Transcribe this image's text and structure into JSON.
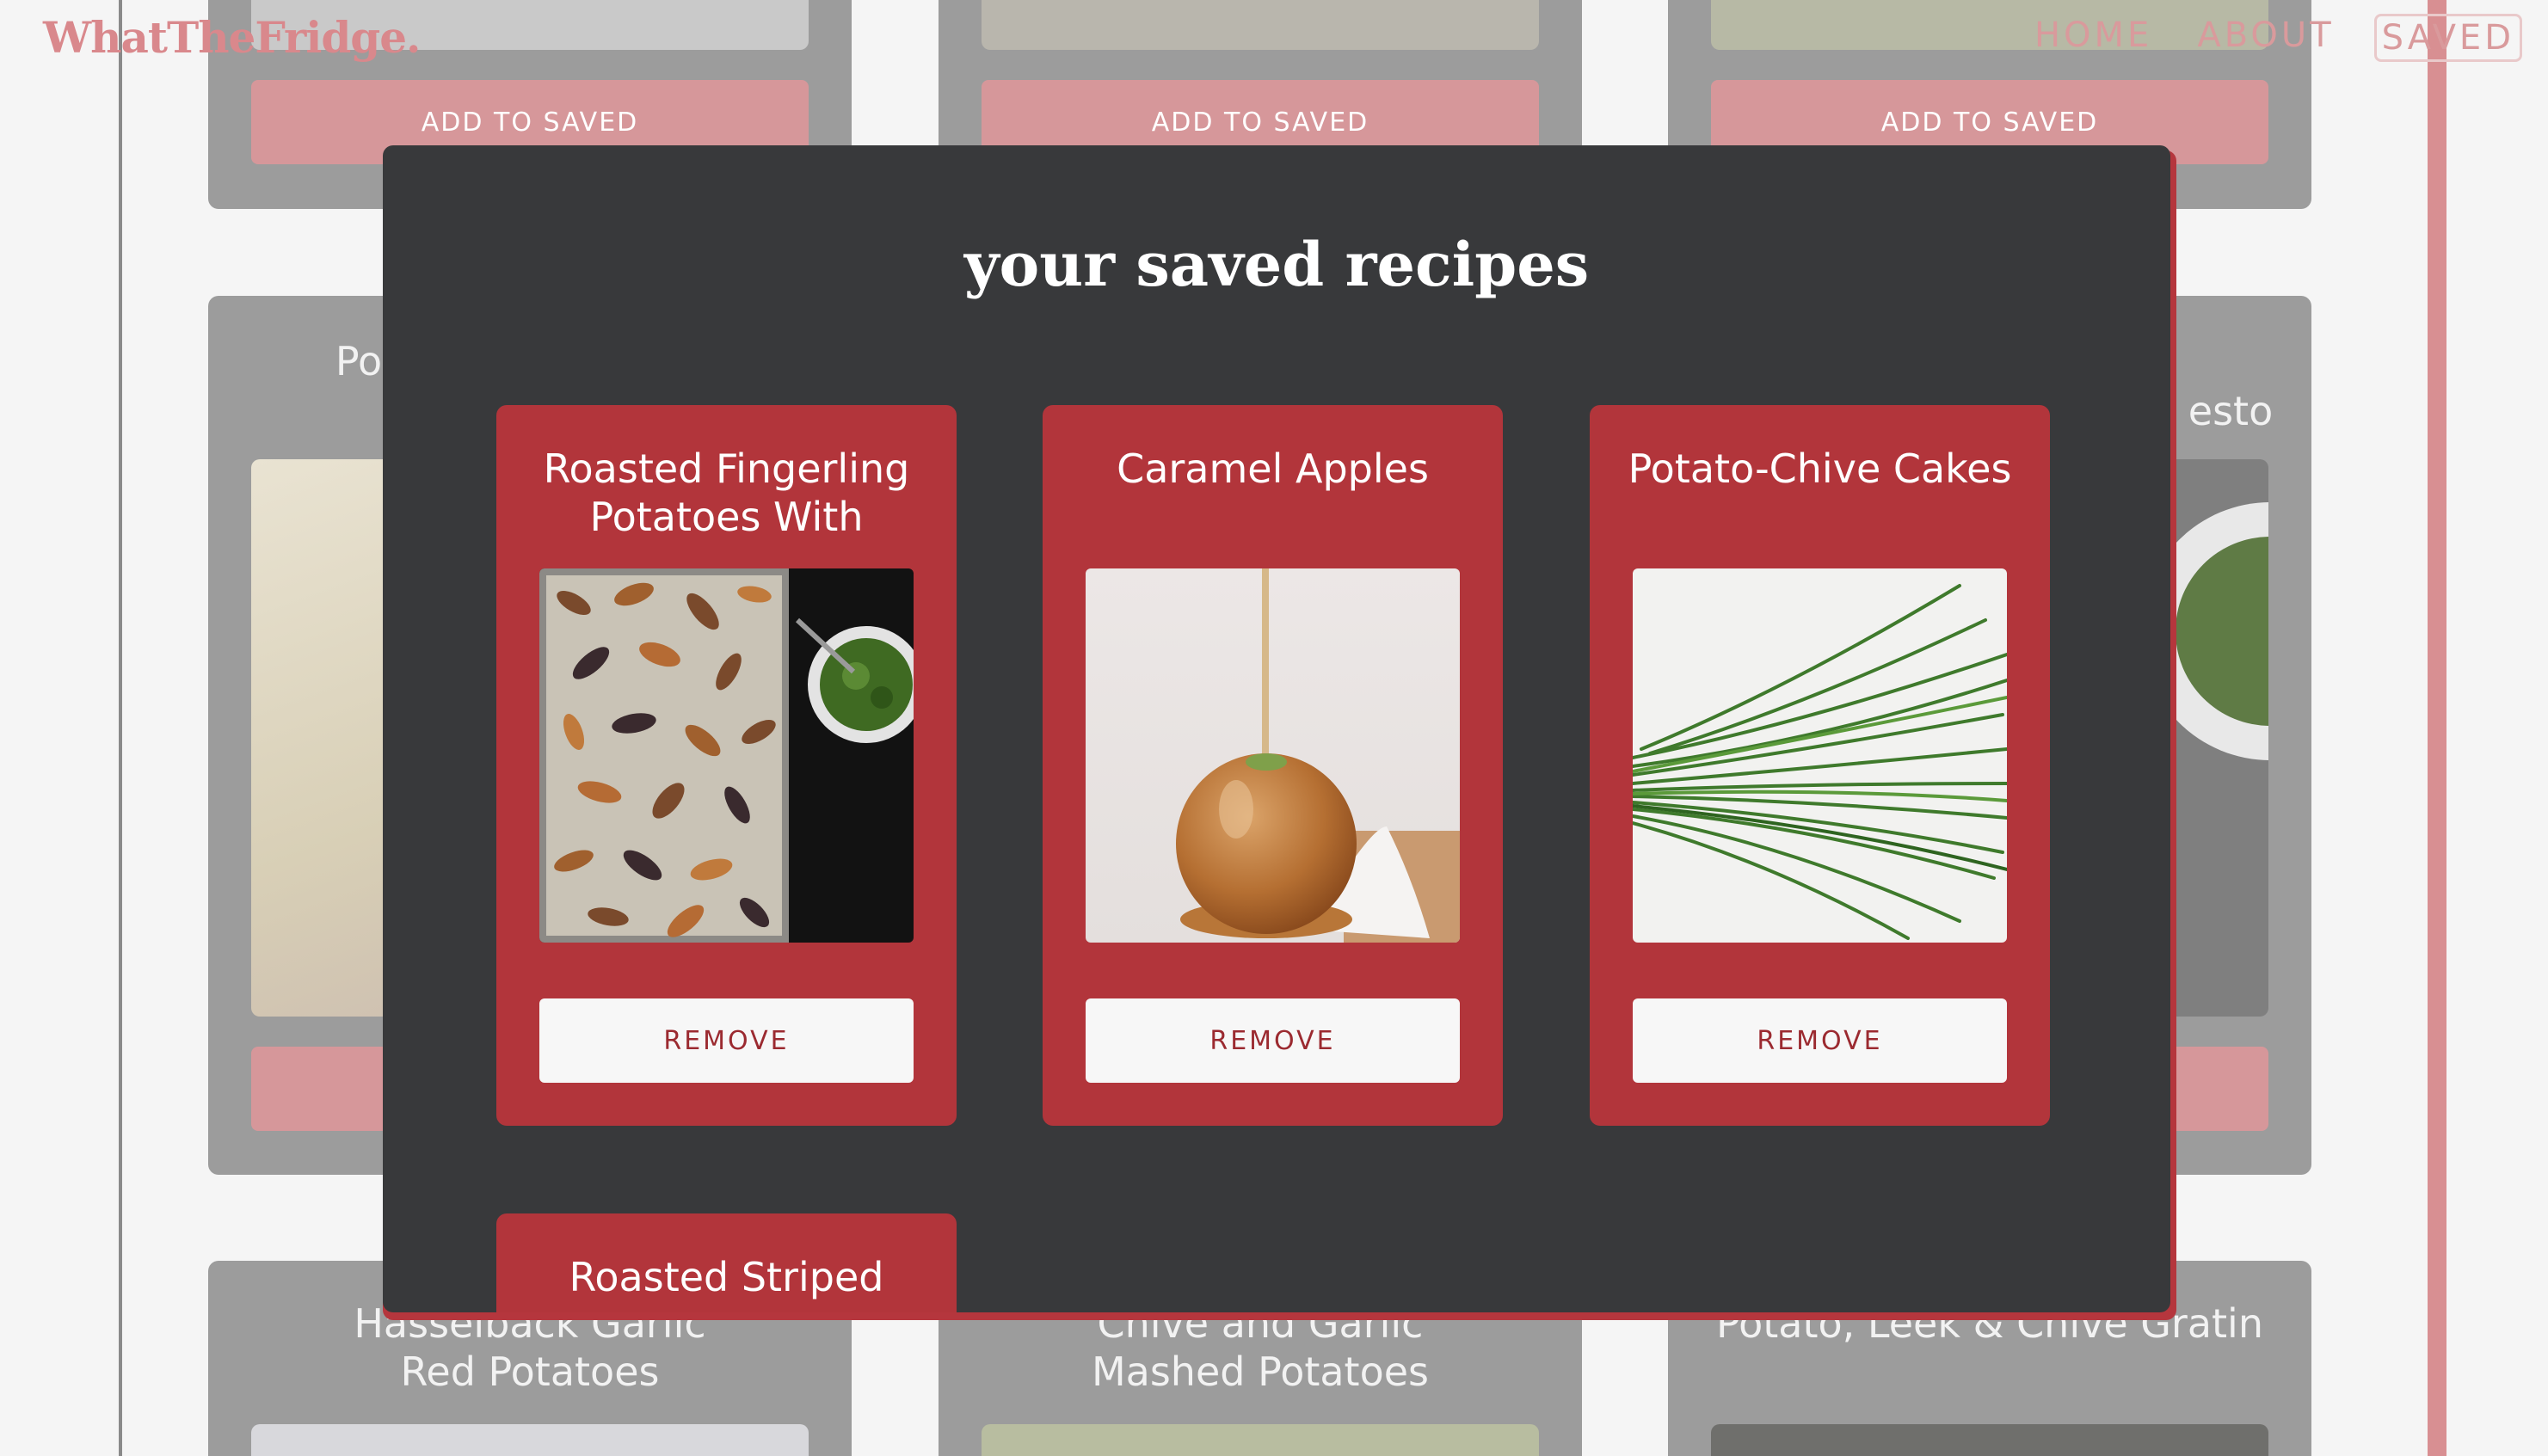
{
  "brand": {
    "logo": "WhatTheFridge."
  },
  "nav": {
    "home": "HOME",
    "about": "ABOUT",
    "saved": "SAVED"
  },
  "background": {
    "add_label": "ADD TO SAVED",
    "middle_row": {
      "left_title_fragment": "Pot",
      "right_title_fragment": "esto"
    },
    "bottom_row": [
      "Hasselback Garlic Red Potatoes",
      "Chive and Garlic Mashed Potatoes",
      "Potato, Leek & Chive Gratin"
    ]
  },
  "modal": {
    "title": "your saved recipes",
    "remove_label": "REMOVE",
    "recipes": [
      {
        "title": "Roasted Fingerling Potatoes With"
      },
      {
        "title": "Caramel Apples"
      },
      {
        "title": "Potato-Chive Cakes"
      },
      {
        "title": "Roasted Striped"
      }
    ]
  }
}
